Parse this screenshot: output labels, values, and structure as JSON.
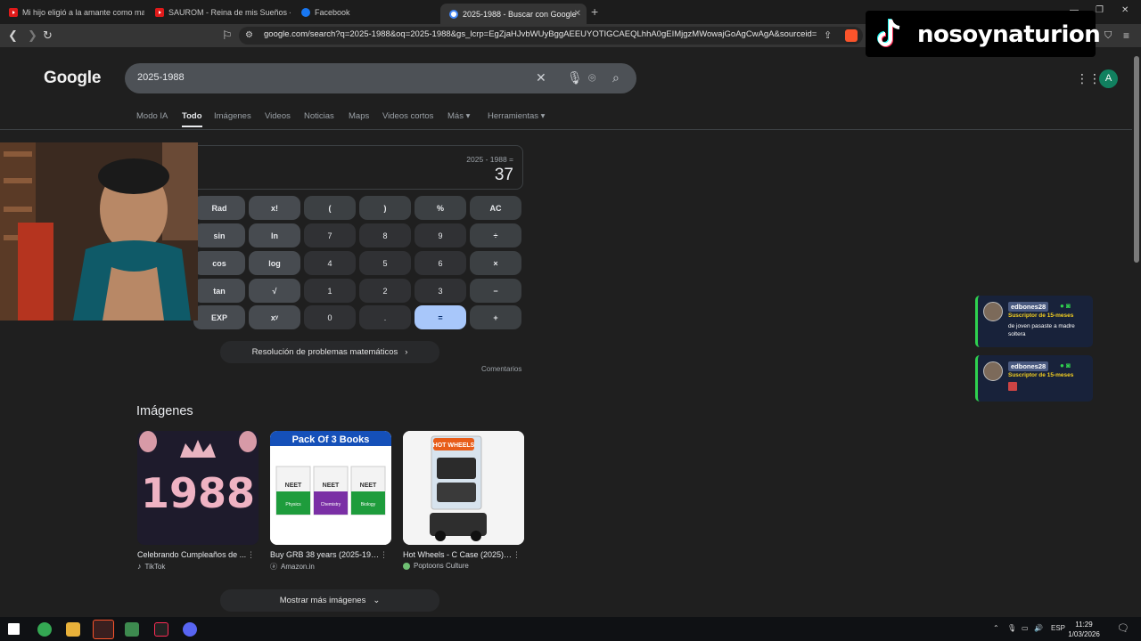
{
  "browser": {
    "tabs": [
      {
        "title": "Mi hijo eligió a la amante como mad",
        "icon": "youtube-icon"
      },
      {
        "title": "SAUROM - Reina de mis Sueños - Yo",
        "icon": "youtube-icon"
      },
      {
        "title": "Facebook",
        "icon": "facebook-icon"
      },
      {
        "title": "2025-1988 - Buscar con Google",
        "icon": "google-icon"
      }
    ],
    "url": "google.com/search?q=2025-1988&oq=2025-1988&gs_lcrp=EgZjaHJvbWUyBggAEEUYOTIGCAEQLhhA0gEIMjgzMWowajGoAgCwAgA&sourceid=chr..."
  },
  "google": {
    "logo": "Google",
    "query": "2025-1988",
    "account_initial": "A",
    "nav_tabs": [
      "Modo IA",
      "Todo",
      "Imágenes",
      "Videos",
      "Noticias",
      "Maps",
      "Videos cortos",
      "Más",
      "Herramientas"
    ],
    "active_tab": "Todo"
  },
  "calculator": {
    "expression": "2025 - 1988 =",
    "result": "37",
    "keys": [
      [
        "Rad",
        "x!",
        "(",
        ")",
        "%",
        "AC"
      ],
      [
        "sin",
        "ln",
        "7",
        "8",
        "9",
        "÷"
      ],
      [
        "cos",
        "log",
        "4",
        "5",
        "6",
        "×"
      ],
      [
        "tan",
        "√",
        "1",
        "2",
        "3",
        "−"
      ],
      [
        "EXP",
        "xʸ",
        "0",
        ".",
        "=",
        "+"
      ]
    ],
    "math_button": "Resolución de problemas matemáticos",
    "feedback": "Comentarios"
  },
  "images": {
    "heading": "Imágenes",
    "items": [
      {
        "caption": "Celebrando Cumpleaños de ...",
        "source": "TikTok",
        "thumb_text": "1988"
      },
      {
        "caption": "Buy GRB 38 years (2025-198...",
        "source": "Amazon.in",
        "thumb_text": "Pack Of 3 Books",
        "book_labels": [
          "Physics",
          "Chemistry",
          "Biology"
        ],
        "book_title": "NEET"
      },
      {
        "caption": "Hot Wheels - C Case (2025) -...",
        "source": "Poptoons Culture",
        "thumb_text": "HOT WHEELS"
      }
    ],
    "show_more": "Mostrar más imágenes"
  },
  "overlay": {
    "tiktok_name": "nosoynaturion",
    "chats": [
      {
        "user": "edbones28",
        "badge": "Suscriptor de 15-meses",
        "message": "de joven pasaste a madre soltera"
      },
      {
        "user": "edbones28",
        "badge": "Suscriptor de 15-meses",
        "message": ""
      }
    ]
  },
  "taskbar": {
    "language": "ESP",
    "time": "11:29",
    "date": "1/03/2026"
  }
}
